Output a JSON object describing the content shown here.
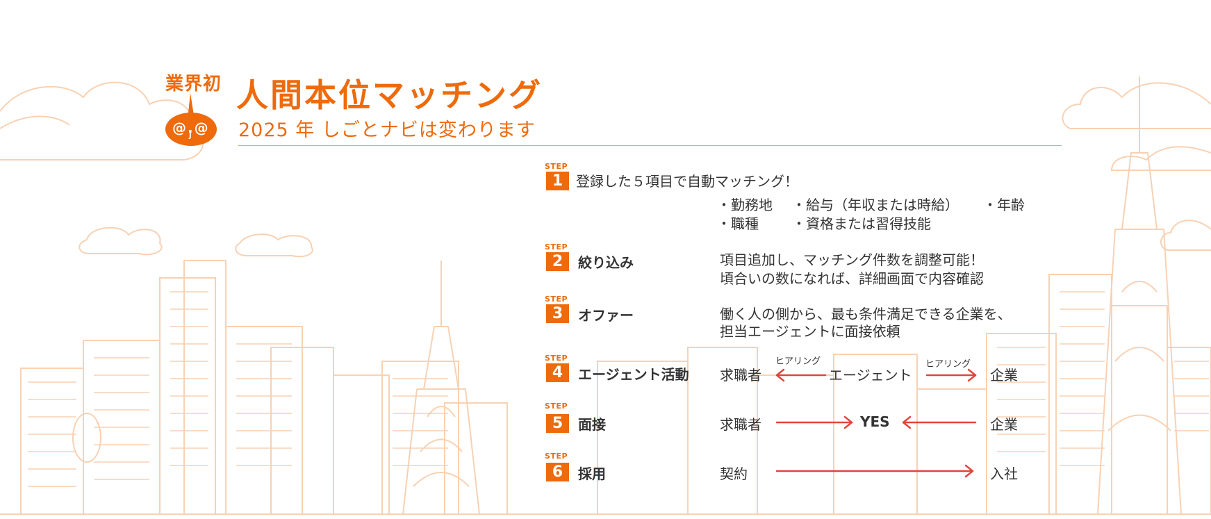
{
  "badge": {
    "text": "業界初",
    "mascot_face": "@.@",
    "mascot_mouth": "J"
  },
  "header": {
    "title": "人間本位マッチング",
    "subtitle": "2025 年 しごとナビは変わります"
  },
  "step_tag": "STEP",
  "steps": [
    {
      "num": "1",
      "label": "登録した５項目で自動マッチング！",
      "bullets": [
        "・勤務地",
        "・給与（年収または時給）",
        "・年齢",
        "・職種",
        "・資格または習得技能"
      ]
    },
    {
      "num": "2",
      "label": "絞り込み",
      "lines": [
        "項目追加し、マッチング件数を調整可能！",
        "頃合いの数になれば、詳細画面で内容確認"
      ]
    },
    {
      "num": "3",
      "label": "オファー",
      "lines": [
        "働く人の側から、最も条件満足できる企業を、",
        "担当エージェントに面接依頼"
      ]
    },
    {
      "num": "4",
      "label": "エージェント活動",
      "flow": {
        "left": "求職者",
        "hearing_left": "ヒアリング",
        "middle": "エージェント",
        "hearing_right": "ヒアリング",
        "right": "企業"
      }
    },
    {
      "num": "5",
      "label": "面接",
      "flow": {
        "left": "求職者",
        "middle": "YES",
        "right": "企業"
      }
    },
    {
      "num": "6",
      "label": "採用",
      "flow": {
        "left": "契約",
        "right": "入社"
      }
    }
  ],
  "colors": {
    "accent": "#ee6a0b",
    "arrow": "#e0463c",
    "skyline": "#f7c9a6",
    "text": "#333333"
  }
}
